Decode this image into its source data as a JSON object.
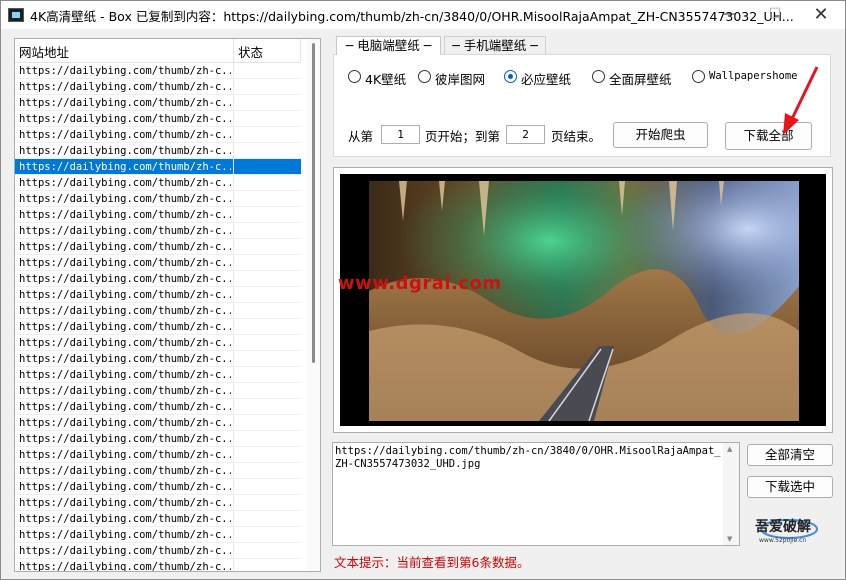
{
  "window": {
    "title": "4K高清壁纸 - Box   已复制到内容：https://dailybing.com/thumb/zh-cn/3840/0/OHR.MisoolRajaAmpat_ZH-CN3557473032_UH...",
    "minimize": "—",
    "maximize": "☐",
    "close": "✕"
  },
  "list": {
    "columns": [
      "网站地址",
      "状态"
    ],
    "row_text": "https://dailybing.com/thumb/zh-c...",
    "row_count": 32,
    "selected_index": 6
  },
  "tabs": [
    {
      "label": "电脑端壁纸",
      "active": true
    },
    {
      "label": "手机端壁纸",
      "active": false
    }
  ],
  "sources": [
    {
      "label": "4K壁纸",
      "checked": false
    },
    {
      "label": "彼岸图网",
      "checked": false
    },
    {
      "label": "必应壁纸",
      "checked": true
    },
    {
      "label": "全面屏壁纸",
      "checked": false
    },
    {
      "label": "Wallpapershome",
      "checked": false
    }
  ],
  "range": {
    "from_label": "从第",
    "start_value": "1",
    "start_suffix": "页开始；到第",
    "end_value": "2",
    "end_suffix": "页结束。"
  },
  "buttons": {
    "start": "开始爬虫",
    "download_all": "下载全部",
    "clear_all": "全部清空",
    "download_selected": "下载选中"
  },
  "preview": {
    "watermark": "www.dgrai.com"
  },
  "textbox": {
    "value": "https://dailybing.com/thumb/zh-cn/3840/0/OHR.MisoolRajaAmpat_ZH-CN3557473032_UHD.jpg"
  },
  "logo": {
    "text": "吾爱破解",
    "subtext": "www.52pojie.cn"
  },
  "status": {
    "text": "文本提示：当前查看到第6条数据。"
  },
  "colors": {
    "selection": "#0078d7",
    "status_red": "#d40000",
    "arrow_red": "#e8141b",
    "radio_blue": "#0060c0"
  }
}
